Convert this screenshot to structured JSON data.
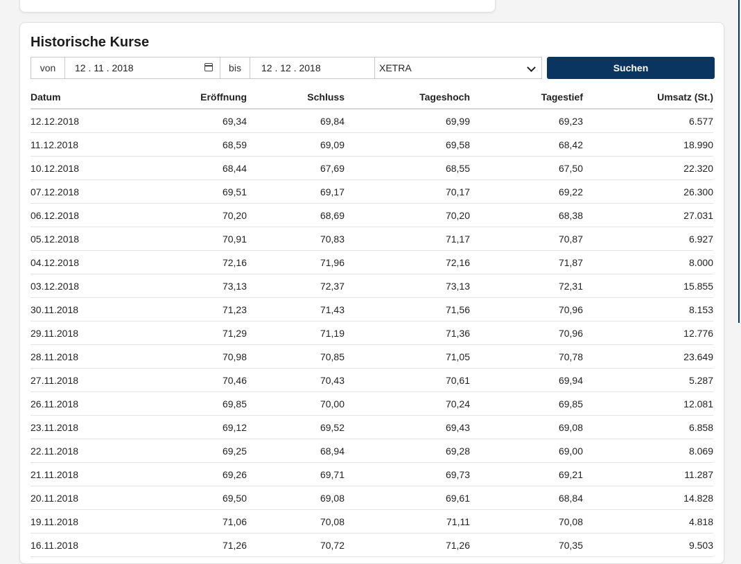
{
  "section": {
    "title": "Historische Kurse"
  },
  "filter": {
    "from_label": "von",
    "from_date": "12 . 11 . 2018",
    "to_label": "bis",
    "to_date": "12 . 12 . 2018",
    "exchange": "XETRA",
    "search_label": "Suchen"
  },
  "colors": {
    "accent": "#0a3561"
  },
  "table": {
    "columns": [
      "Datum",
      "Eröffnung",
      "Schluss",
      "Tageshoch",
      "Tagestief",
      "Umsatz (St.)"
    ],
    "rows": [
      [
        "12.12.2018",
        "69,34",
        "69,84",
        "69,99",
        "69,23",
        "6.577"
      ],
      [
        "11.12.2018",
        "68,59",
        "69,09",
        "69,58",
        "68,42",
        "18.990"
      ],
      [
        "10.12.2018",
        "68,44",
        "67,69",
        "68,55",
        "67,50",
        "22.320"
      ],
      [
        "07.12.2018",
        "69,51",
        "69,17",
        "70,17",
        "69,22",
        "26.300"
      ],
      [
        "06.12.2018",
        "70,20",
        "68,69",
        "70,20",
        "68,38",
        "27.031"
      ],
      [
        "05.12.2018",
        "70,91",
        "70,83",
        "71,17",
        "70,87",
        "6.927"
      ],
      [
        "04.12.2018",
        "72,16",
        "71,96",
        "72,16",
        "71,87",
        "8.000"
      ],
      [
        "03.12.2018",
        "73,13",
        "72,37",
        "73,13",
        "72,31",
        "15.855"
      ],
      [
        "30.11.2018",
        "71,23",
        "71,43",
        "71,56",
        "70,96",
        "8.153"
      ],
      [
        "29.11.2018",
        "71,29",
        "71,19",
        "71,36",
        "70,96",
        "12.776"
      ],
      [
        "28.11.2018",
        "70,98",
        "70,85",
        "71,05",
        "70,78",
        "23.649"
      ],
      [
        "27.11.2018",
        "70,46",
        "70,43",
        "70,61",
        "69,94",
        "5.287"
      ],
      [
        "26.11.2018",
        "69,85",
        "70,00",
        "70,24",
        "69,85",
        "12.081"
      ],
      [
        "23.11.2018",
        "69,12",
        "69,52",
        "69,43",
        "69,08",
        "6.858"
      ],
      [
        "22.11.2018",
        "69,25",
        "68,94",
        "69,28",
        "69,00",
        "8.069"
      ],
      [
        "21.11.2018",
        "69,26",
        "69,71",
        "69,73",
        "69,21",
        "11.287"
      ],
      [
        "20.11.2018",
        "69,50",
        "69,08",
        "69,61",
        "68,84",
        "14.828"
      ],
      [
        "19.11.2018",
        "71,06",
        "70,08",
        "71,11",
        "70,08",
        "4.818"
      ],
      [
        "16.11.2018",
        "71,26",
        "70,72",
        "71,26",
        "70,35",
        "9.503"
      ]
    ]
  }
}
